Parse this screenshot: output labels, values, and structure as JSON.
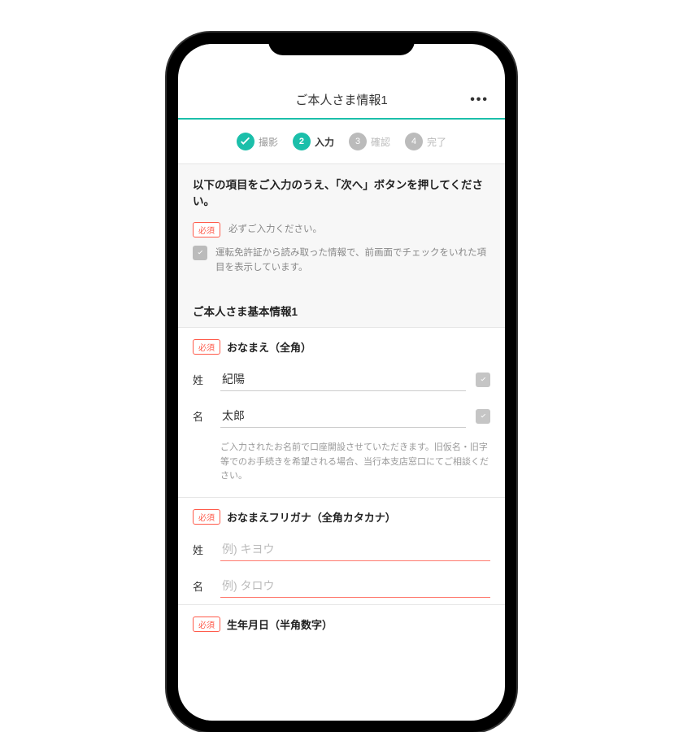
{
  "header": {
    "title": "ご本人さま情報1",
    "more": "•••"
  },
  "stepper": {
    "steps": [
      {
        "icon": "check",
        "label": "撮影",
        "state": "done"
      },
      {
        "num": "2",
        "label": "入力",
        "state": "active"
      },
      {
        "num": "3",
        "label": "確認",
        "state": "pending"
      },
      {
        "num": "4",
        "label": "完了",
        "state": "pending"
      }
    ]
  },
  "instruction": {
    "title": "以下の項目をご入力のうえ、「次へ」ボタンを押してください。",
    "required_badge": "必須",
    "required_text": "必ずご入力ください。",
    "checked_text": "運転免許証から読み取った情報で、前画面でチェックをいれた項目を表示しています。"
  },
  "section_title": "ご本人さま基本情報1",
  "fields": {
    "name": {
      "badge": "必須",
      "title": "おなまえ（全角）",
      "sei_label": "姓",
      "sei_value": "紀陽",
      "mei_label": "名",
      "mei_value": "太郎",
      "helper": "ご入力されたお名前で口座開設させていただきます。旧仮名・旧字等でのお手続きを希望される場合、当行本支店窓口にてご相談ください。"
    },
    "furigana": {
      "badge": "必須",
      "title": "おなまえフリガナ（全角カタカナ）",
      "sei_label": "姓",
      "sei_placeholder": "例) キヨウ",
      "mei_label": "名",
      "mei_placeholder": "例) タロウ"
    },
    "birthdate": {
      "badge": "必須",
      "title": "生年月日（半角数字）"
    }
  }
}
